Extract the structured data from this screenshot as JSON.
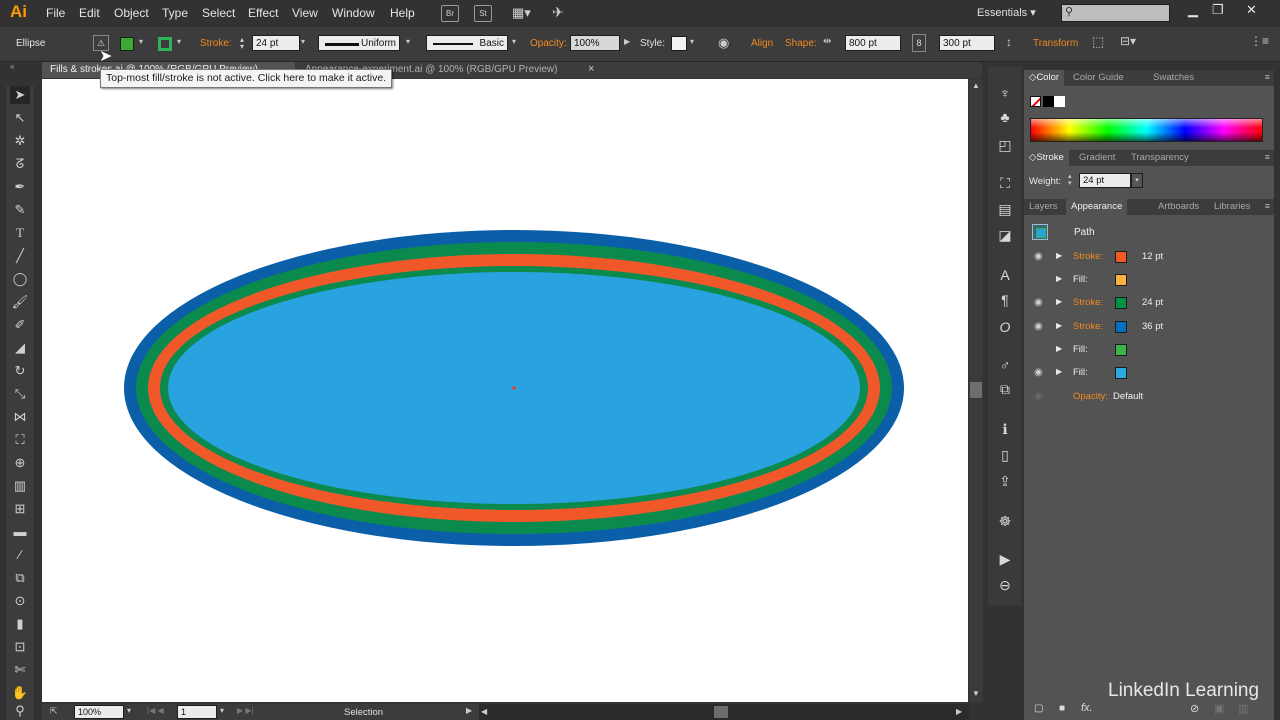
{
  "menubar": {
    "app_logo": "Ai",
    "items": [
      "File",
      "Edit",
      "Object",
      "Type",
      "Select",
      "Effect",
      "View",
      "Window",
      "Help"
    ],
    "bridge_label": "Br",
    "stock_label": "St",
    "workspace": "Essentials"
  },
  "control": {
    "selection_type": "Ellipse",
    "stroke_label": "Stroke:",
    "stroke_weight": "24 pt",
    "profile": "Uniform",
    "brush": "Basic",
    "opacity_label": "Opacity:",
    "opacity_value": "100%",
    "style_label": "Style:",
    "align_label": "Align",
    "shape_label": "Shape:",
    "width_value": "800 pt",
    "height_value": "300 pt",
    "transform_label": "Transform",
    "fill_color": "#3aaa35",
    "stroke_color": "#00a651"
  },
  "tabs": {
    "active": "Fills & strokes.ai @ 100% (RGB/GPU Preview)",
    "inactive": "Appearance-experiment.ai @ 100% (RGB/GPU Preview)",
    "close": "×"
  },
  "tooltip": "Top-most fill/stroke is not active. Click here to make it active.",
  "status": {
    "zoom": "100%",
    "artboard": "1",
    "tool": "Selection"
  },
  "color_panel": {
    "tabs": [
      "Color",
      "Color Guide",
      "Swatches"
    ]
  },
  "stroke_panel": {
    "tabs": [
      "Stroke",
      "Gradient",
      "Transparency"
    ],
    "weight_label": "Weight:",
    "weight_value": "24 pt"
  },
  "appearance_panel": {
    "tabs": [
      "Layers",
      "Appearance",
      "Artboards",
      "Libraries"
    ],
    "object": "Path",
    "rows": [
      {
        "visible": true,
        "label": "Stroke:",
        "color": "#f15a24",
        "value": "12 pt"
      },
      {
        "visible": false,
        "label": "Fill:",
        "color": "#fbb040",
        "value": ""
      },
      {
        "visible": true,
        "label": "Stroke:",
        "color": "#009245",
        "value": "24 pt"
      },
      {
        "visible": true,
        "label": "Stroke:",
        "color": "#0071bc",
        "value": "36 pt"
      },
      {
        "visible": false,
        "label": "Fill:",
        "color": "#39b54a",
        "value": ""
      },
      {
        "visible": true,
        "label": "Fill:",
        "color": "#29abe2",
        "value": ""
      }
    ],
    "opacity_label": "Opacity:",
    "opacity_value": "Default"
  },
  "ellipse": {
    "outer_stroke": "#0a5fa8",
    "green_stroke": "#0b8a4e",
    "orange_stroke": "#f0582a",
    "fill": "#29a3e0"
  },
  "watermark": "LinkedIn Learning"
}
